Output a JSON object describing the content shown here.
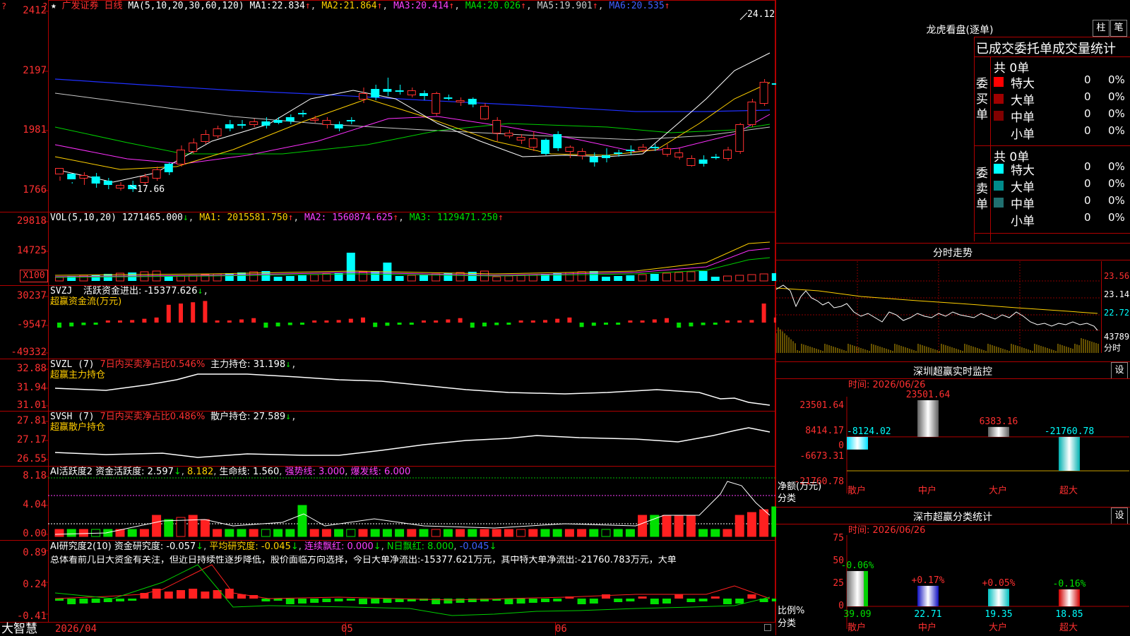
{
  "chart": {
    "top_icons": [
      "?",
      "★",
      "?"
    ],
    "stock_name": "广发证券",
    "period": "日线",
    "ma_head": "MA(5,10,20,30,60,120)",
    "ma": [
      {
        "label": "MA1:",
        "value": "22.834",
        "color": "#ffffff"
      },
      {
        "label": "MA2:",
        "value": "21.864",
        "color": "#ffd000"
      },
      {
        "label": "MA3:",
        "value": "20.414",
        "color": "#ff40ff"
      },
      {
        "label": "MA4:",
        "value": "20.026",
        "color": "#00e000"
      },
      {
        "label": "MA5:",
        "value": "19.901",
        "color": "#cccccc"
      },
      {
        "label": "MA6:",
        "value": "20.535",
        "color": "#4060ff"
      }
    ],
    "price_axis": [
      "2412",
      "2197",
      "1981",
      "1766"
    ],
    "high_marker": "24.12",
    "low_marker": "17.66",
    "volume": {
      "head": "VOL(5,10,20)",
      "value": "1271465.000",
      "ma1": "MA1: 2015581.750",
      "ma2": "MA2: 1560874.625",
      "ma3": "MA3: 1129471.250",
      "axis": [
        "29818",
        "14725"
      ],
      "unit_box": "X100"
    },
    "svzj": {
      "head": "SVZJ",
      "label": "活跃资金进出: -15377.626",
      "subtitle": "超赢资金流(万元)",
      "axis": [
        "30237",
        "-9547",
        "-49332"
      ]
    },
    "svzl": {
      "head": "SVZL (7)",
      "red_text": "7日内买卖净占比0.546%",
      "label": "主力持仓: 31.198",
      "subtitle": "超赢主力持仓",
      "axis": [
        "32.88",
        "31.94",
        "31.01"
      ]
    },
    "svsh": {
      "head": "SVSH (7)",
      "red_text": "7日内买卖净占比0.486%",
      "label": "散户持仓: 27.589",
      "subtitle": "超赢散户持仓",
      "axis": [
        "27.81",
        "27.17",
        "26.55"
      ]
    },
    "ai_active": {
      "head": "AI活跃度2",
      "label1": "资金活跃度: 2.597",
      "label2": "8.182",
      "label3": "生命线: 1.560",
      "label4": "强势线: 3.000",
      "label5": "爆发线: 6.000",
      "axis": [
        "8.18",
        "4.04",
        "0.00"
      ]
    },
    "ai_research": {
      "head": "AI研究度2(10)",
      "label1": "资金研究度: -0.057",
      "label2": "平均研究度: -0.045",
      "label3": "连续飘红: 0.000",
      "label4": "N日飘红: 8.000",
      "label5": "-0.045",
      "summary": "总体看前几日大资金有关注，但近日持续性逐步降低，股价面临方向选择，今日大单净流出:-15377.621万元，其中特大单净流出:-21760.783万元，大单",
      "axis": [
        "0.89",
        "0.24",
        "-0.41"
      ]
    },
    "x_axis": {
      "start": "2026/04",
      "m1": "05",
      "m2": "06"
    },
    "footer_name": "大智慧"
  },
  "dragon": {
    "title": "龙虎看盘(逐单)",
    "btn1": "柱",
    "btn2": "笔",
    "header": "已成交委托单成交量统计",
    "buy_side_label": "委买单",
    "sell_side_label": "委卖单",
    "buy_total": "共 0单",
    "sell_total": "共 0单",
    "buy_rows": [
      {
        "name": "特大",
        "count": "0",
        "pct": "0%",
        "color": "#ff0000"
      },
      {
        "name": "大单",
        "count": "0",
        "pct": "0%",
        "color": "#a00000"
      },
      {
        "name": "中单",
        "count": "0",
        "pct": "0%",
        "color": "#800000"
      },
      {
        "name": "小单",
        "count": "0",
        "pct": "0%",
        "color": "#000000"
      }
    ],
    "sell_rows": [
      {
        "name": "特大",
        "count": "0",
        "pct": "0%",
        "color": "#00ffff"
      },
      {
        "name": "大单",
        "count": "0",
        "pct": "0%",
        "color": "#008b8b"
      },
      {
        "name": "中单",
        "count": "0",
        "pct": "0%",
        "color": "#207070"
      },
      {
        "name": "小单",
        "count": "0",
        "pct": "0%",
        "color": "#000000"
      }
    ]
  },
  "intraday": {
    "title": "分时走势",
    "axis": [
      "23.56",
      "23.14",
      "22.72",
      "43789"
    ],
    "unit": "分时"
  },
  "monitor": {
    "title": "深圳超赢实时监控",
    "btn": "设",
    "time": "时间: 2026/06/26",
    "axis": [
      "23501.64",
      "8414.17",
      "0",
      "-6673.31",
      "-21760.78"
    ],
    "y_caption": "净额(万元)",
    "x_caption": "分类",
    "categories": [
      "散户",
      "中户",
      "大户",
      "超大"
    ],
    "values_label": [
      "-8124.02",
      "23501.64",
      "6383.16",
      "-21760.78"
    ],
    "values": [
      -8124.02,
      23501.64,
      6383.16,
      -21760.78
    ]
  },
  "classify": {
    "title": "深市超赢分类统计",
    "btn": "设",
    "time": "时间: 2026/06/26",
    "axis": [
      "75",
      "50",
      "25",
      "0"
    ],
    "y_caption": "比例%",
    "x_caption": "分类",
    "categories": [
      "散户",
      "中户",
      "大户",
      "超大"
    ],
    "pct_change": [
      "-0.06%",
      "+0.17%",
      "+0.05%",
      "-0.16%"
    ],
    "values_label": [
      "39.09",
      "22.71",
      "19.35",
      "18.85"
    ],
    "values": [
      39.09,
      22.71,
      19.35,
      18.85
    ]
  },
  "chart_data": [
    {
      "type": "bar",
      "title": "深圳超赢实时监控",
      "categories": [
        "散户",
        "中户",
        "大户",
        "超大"
      ],
      "values": [
        -8124.02,
        23501.64,
        6383.16,
        -21760.78
      ],
      "ylabel": "净额(万元)",
      "xlabel": "分类",
      "ylim": [
        -21760.78,
        23501.64
      ]
    },
    {
      "type": "bar",
      "title": "深市超赢分类统计",
      "categories": [
        "散户",
        "中户",
        "大户",
        "超大"
      ],
      "values": [
        39.09,
        22.71,
        19.35,
        18.85
      ],
      "ylabel": "比例%",
      "xlabel": "分类",
      "ylim": [
        0,
        75
      ]
    }
  ]
}
